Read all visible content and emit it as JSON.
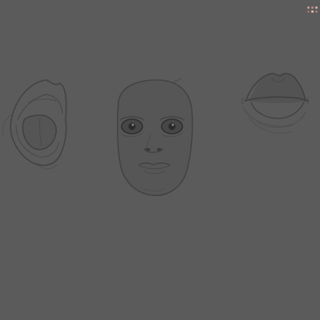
{
  "canvas": {
    "background": "#5b5b5b",
    "stroke_color": "#3f3f3f",
    "shade_color": "#545454",
    "highlight_color": "#666666"
  },
  "sketches": [
    {
      "name": "open-mouth-tongue-sketch"
    },
    {
      "name": "face-portrait-sketch"
    },
    {
      "name": "closed-lips-sketch"
    }
  ],
  "palette": {
    "colors": [
      "#c79a92",
      "#b58a8a",
      "#d6b0a2",
      "#9a6d6d",
      "#e0bfae",
      "#a87c76"
    ]
  }
}
